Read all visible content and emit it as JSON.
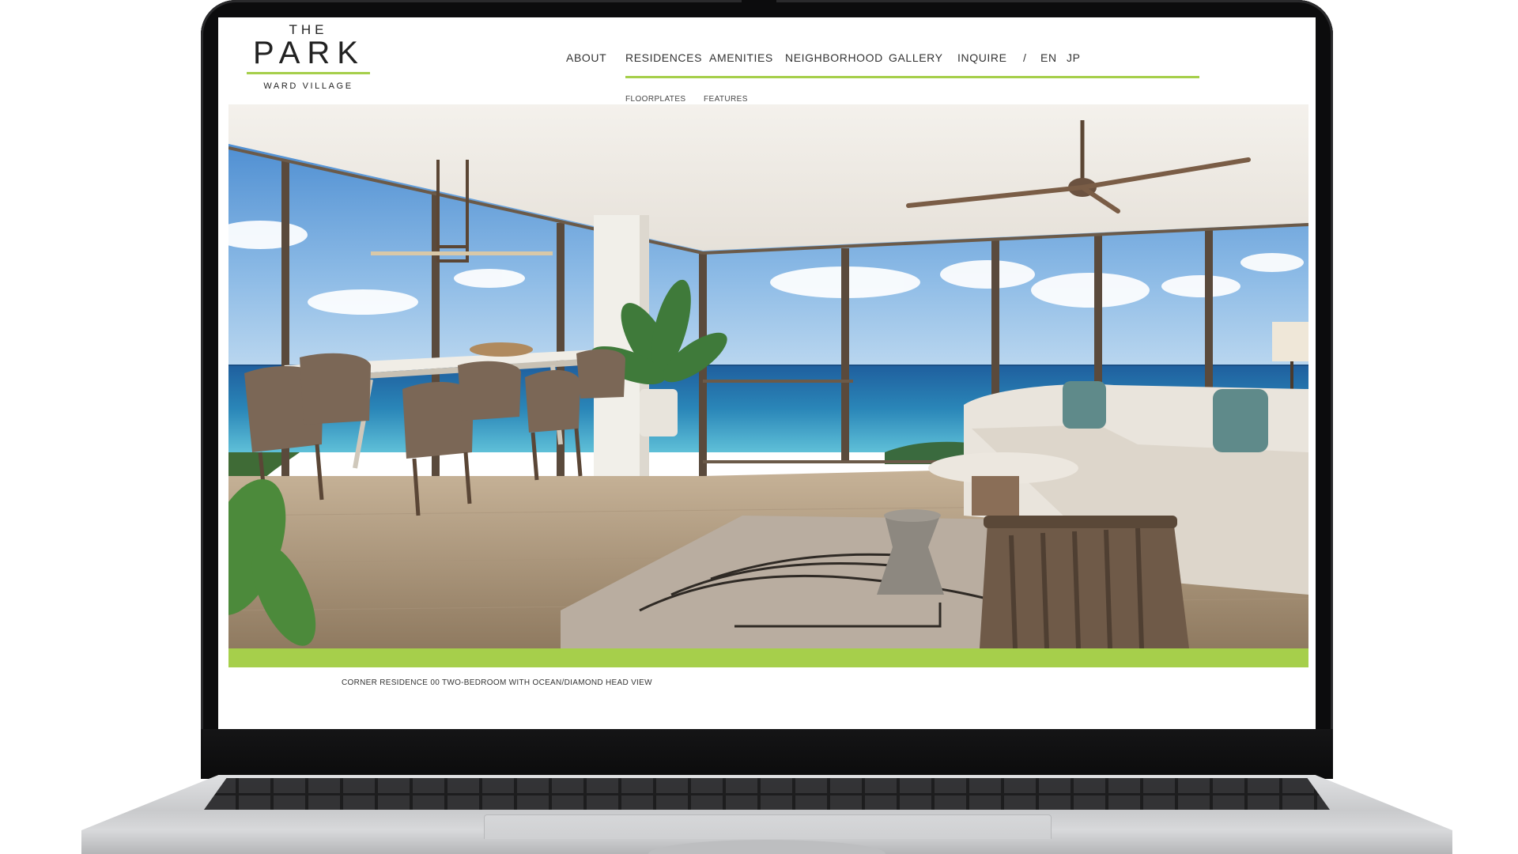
{
  "logo": {
    "the": "THE",
    "park": "PARK",
    "ward_village": "WARD VILLAGE"
  },
  "nav": {
    "items": [
      {
        "label": "ABOUT"
      },
      {
        "label": "RESIDENCES"
      },
      {
        "label": "AMENITIES"
      },
      {
        "label": "NEIGHBORHOOD"
      },
      {
        "label": "GALLERY"
      },
      {
        "label": "INQUIRE"
      }
    ],
    "separator": "/",
    "languages": [
      "EN",
      "JP"
    ],
    "sub_items": [
      {
        "label": "FLOORPLATES"
      },
      {
        "label": "FEATURES"
      }
    ]
  },
  "hero": {
    "caption": "CORNER RESIDENCE 00 TWO-BEDROOM WITH OCEAN/DIAMOND HEAD VIEW"
  },
  "colors": {
    "accent_green": "#a6cf4b",
    "text": "#333333",
    "laptop_body": "#0c0c0d"
  }
}
